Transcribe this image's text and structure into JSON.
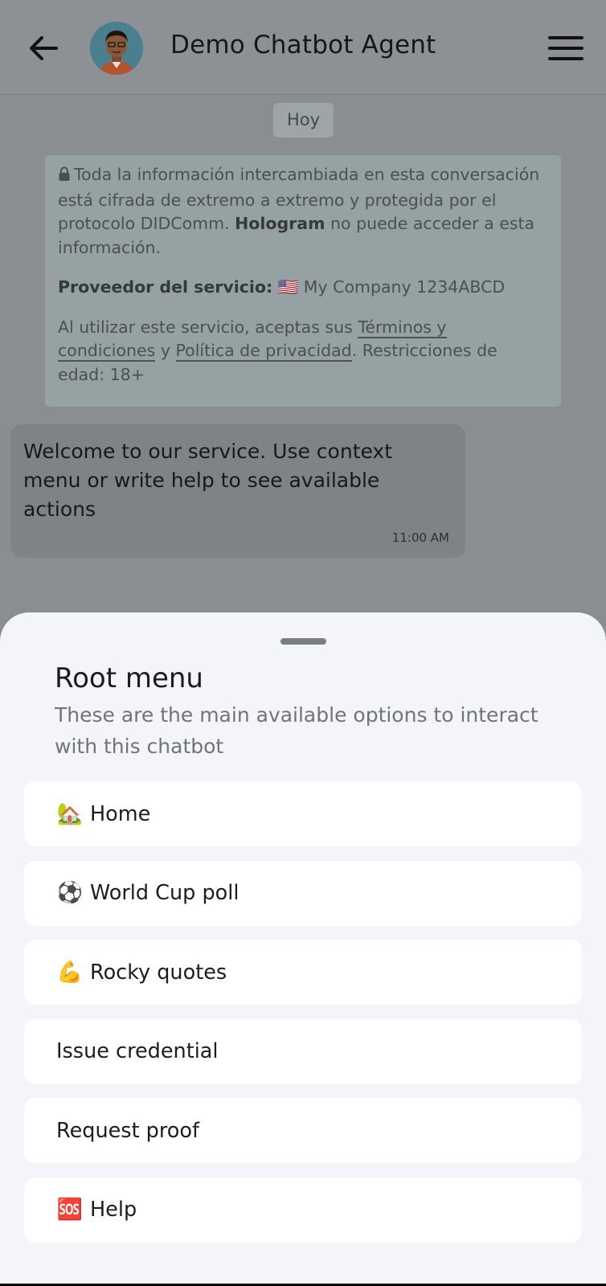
{
  "header": {
    "title": "Demo Chatbot Agent",
    "back_icon": "arrow-left-icon",
    "menu_icon": "hamburger-icon"
  },
  "chat": {
    "date_label": "Hoy",
    "notice": {
      "line1_pre": "Toda la información intercambiada en esta conversación está cifrada de extremo a extremo y protegida por el protocolo DIDComm.",
      "brand": "Hologram",
      "line1_post": "no puede acceder a esta información.",
      "provider_label": "Proveedor del servicio:",
      "provider_flag": "🇺🇸",
      "provider_name": "My Company 1234ABCD",
      "terms_pre": "Al utilizar este servicio, aceptas sus",
      "terms_link": "Términos y condiciones",
      "terms_and": "y",
      "privacy_link": "Política de privacidad",
      "terms_post": ". Restricciones de edad: 18+"
    },
    "message": {
      "text": "Welcome to our service. Use context menu or write help to see available actions",
      "time": "11:00 AM"
    }
  },
  "sheet": {
    "title": "Root menu",
    "subtitle": "These are the main available options to interact with this chatbot",
    "items": [
      {
        "emoji": "🏡",
        "label": "Home"
      },
      {
        "emoji": "⚽",
        "label": "World Cup poll"
      },
      {
        "emoji": "💪",
        "label": "Rocky quotes"
      },
      {
        "emoji": "",
        "label": "Issue credential"
      },
      {
        "emoji": "",
        "label": "Request proof"
      },
      {
        "emoji": "🆘",
        "label": "Help"
      }
    ]
  },
  "colors": {
    "overlay_background": "#8b8e91",
    "sheet_background": "#f3f5f8",
    "item_background": "#ffffff"
  }
}
